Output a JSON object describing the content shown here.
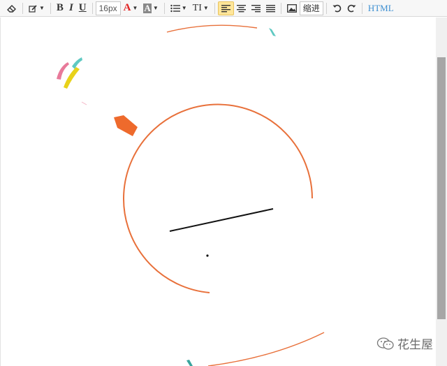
{
  "toolbar": {
    "font_size": "16px",
    "indent_label": "缩进",
    "html_label": "HTML",
    "bold_label": "B",
    "italic_label": "I",
    "underline_label": "U",
    "font_color_label": "A",
    "bg_color_label": "A",
    "text_size_label": "TI",
    "font_color": "#e02020",
    "active_bg": "#ffe69a"
  },
  "watermark": {
    "text": "花生屋"
  },
  "colors": {
    "orange": "#e8703a",
    "teal": "#5fc9c2",
    "yellow": "#e8d21a",
    "pink": "#e87a9a",
    "dark": "#222222"
  }
}
